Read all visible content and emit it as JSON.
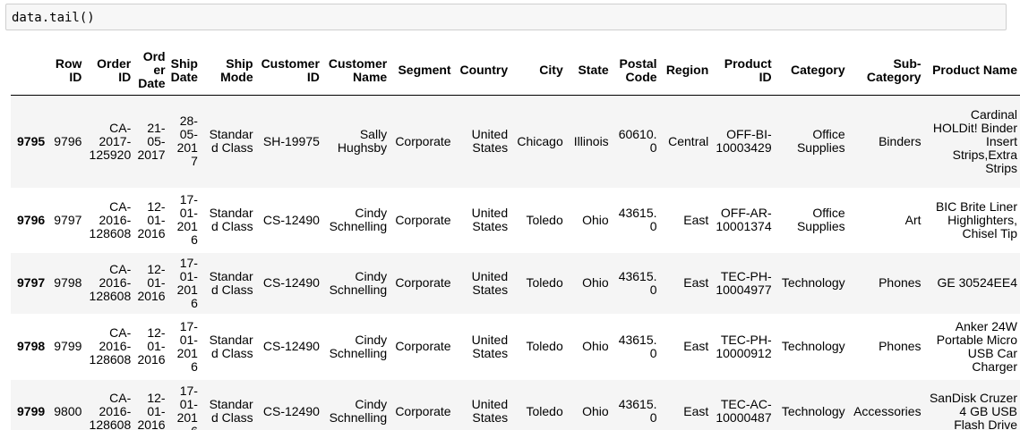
{
  "cell": {
    "code": "data.tail()"
  },
  "table": {
    "columns": [
      "",
      "Row ID",
      "Order ID",
      "Order Date",
      "Ship Date",
      "Ship Mode",
      "Customer ID",
      "Customer Name",
      "Segment",
      "Country",
      "City",
      "State",
      "Postal Code",
      "Region",
      "Product ID",
      "Category",
      "Sub-Category",
      "Product Name"
    ],
    "rows": [
      {
        "index": "9795",
        "cells": [
          "9796",
          "CA-2017-125920",
          "21-05-2017",
          "28-05-2017",
          "Standard Class",
          "SH-19975",
          "Sally Hughsby",
          "Corporate",
          "United States",
          "Chicago",
          "Illinois",
          "60610.0",
          "Central",
          "OFF-BI-10003429",
          "Office Supplies",
          "Binders",
          "Cardinal HOLDit! Binder Insert Strips,Extra Strips"
        ]
      },
      {
        "index": "9796",
        "cells": [
          "9797",
          "CA-2016-128608",
          "12-01-2016",
          "17-01-2016",
          "Standard Class",
          "CS-12490",
          "Cindy Schnelling",
          "Corporate",
          "United States",
          "Toledo",
          "Ohio",
          "43615.0",
          "East",
          "OFF-AR-10001374",
          "Office Supplies",
          "Art",
          "BIC Brite Liner Highlighters, Chisel Tip"
        ]
      },
      {
        "index": "9797",
        "cells": [
          "9798",
          "CA-2016-128608",
          "12-01-2016",
          "17-01-2016",
          "Standard Class",
          "CS-12490",
          "Cindy Schnelling",
          "Corporate",
          "United States",
          "Toledo",
          "Ohio",
          "43615.0",
          "East",
          "TEC-PH-10004977",
          "Technology",
          "Phones",
          "GE 30524EE4"
        ]
      },
      {
        "index": "9798",
        "cells": [
          "9799",
          "CA-2016-128608",
          "12-01-2016",
          "17-01-2016",
          "Standard Class",
          "CS-12490",
          "Cindy Schnelling",
          "Corporate",
          "United States",
          "Toledo",
          "Ohio",
          "43615.0",
          "East",
          "TEC-PH-10000912",
          "Technology",
          "Phones",
          "Anker 24W Portable Micro USB Car Charger"
        ]
      },
      {
        "index": "9799",
        "cells": [
          "9800",
          "CA-2016-128608",
          "12-01-2016",
          "17-01-2016",
          "Standard Class",
          "CS-12490",
          "Cindy Schnelling",
          "Corporate",
          "United States",
          "Toledo",
          "Ohio",
          "43615.0",
          "East",
          "TEC-AC-10000487",
          "Technology",
          "Accessories",
          "SanDisk Cruzer 4 GB USB Flash Drive"
        ]
      }
    ]
  }
}
